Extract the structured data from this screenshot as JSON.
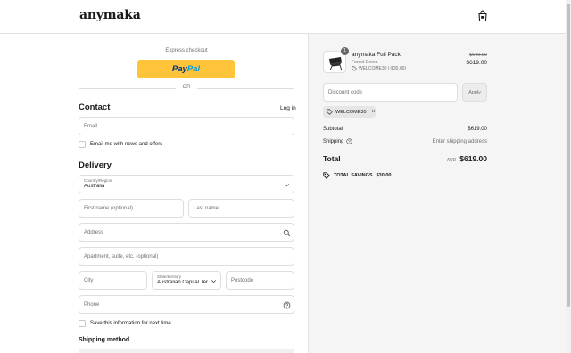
{
  "header": {
    "logo": "anymaka",
    "cart_icon": "shopping-bag-icon"
  },
  "express": {
    "label": "Express checkout",
    "paypal_a": "Pay",
    "paypal_b": "Pal",
    "or": "OR"
  },
  "contact": {
    "title": "Contact",
    "login": "Log in",
    "email_placeholder": "Email",
    "newsletter": "Email me with news and offers"
  },
  "delivery": {
    "title": "Delivery",
    "country_label": "Country/Region",
    "country_value": "Australia",
    "first_name": "First name (optional)",
    "last_name": "Last name",
    "address": "Address",
    "apartment": "Apartment, suite, etc. (optional)",
    "city": "City",
    "state_label": "State/territory",
    "state_value": "Australian Capital Ter...",
    "postcode": "Postcode",
    "phone": "Phone",
    "save_info": "Save this information for next time"
  },
  "shipping_method": {
    "title": "Shipping method"
  },
  "order": {
    "quantity": "1",
    "product_name": "anymaka Full Pack",
    "variant": "Forest Green",
    "discount_line": "WELCOME30 (-$30.00)",
    "price_original": "$649.00",
    "price_final": "$619.00",
    "discount_placeholder": "Discount code",
    "apply": "Apply",
    "applied_code": "WELCOME30",
    "subtotal_label": "Subtotal",
    "subtotal_value": "$619.00",
    "shipping_label": "Shipping",
    "shipping_value": "Enter shipping address",
    "total_label": "Total",
    "currency": "AUD",
    "total_value": "$619.00",
    "savings_label": "TOTAL SAVINGS",
    "savings_value": "$30.00"
  },
  "colors": {
    "paypal_yellow": "#ffc439",
    "paypal_navy": "#003087",
    "paypal_blue": "#009cde",
    "panel_bg": "#f5f5f5"
  }
}
